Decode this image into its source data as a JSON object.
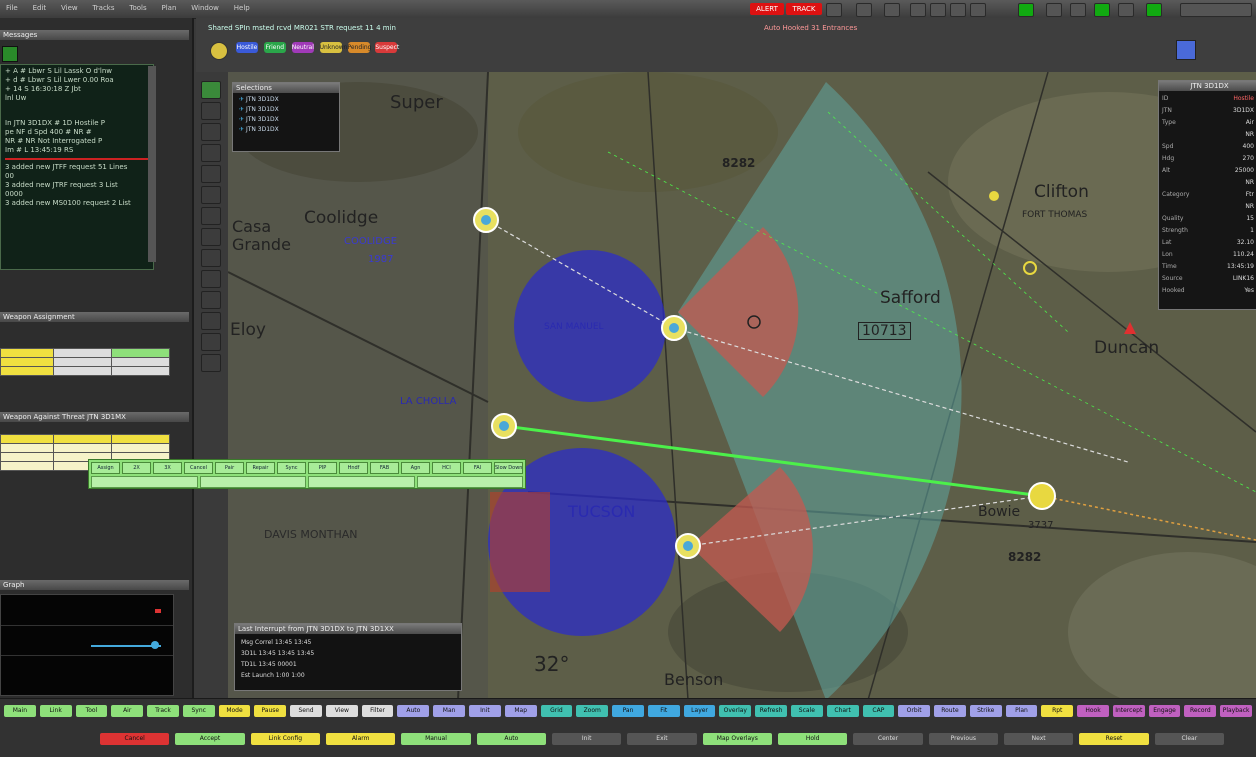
{
  "topbar": {
    "menus": [
      "File",
      "Edit",
      "View",
      "Tracks",
      "Tools",
      "Plan",
      "Window",
      "Help"
    ],
    "alert": "ALERT",
    "alert2": "TRACK"
  },
  "map_header": {
    "status_text": "Shared SPIn msted rcvd MR021 STR request 11 4 min",
    "warning": "Auto Hooked 31 Entrances",
    "filters": [
      "Hostile",
      "Friend",
      "Neutral",
      "Unknown",
      "Pending",
      "Suspect"
    ]
  },
  "left_panel": {
    "messages_title": "Messages",
    "message_lines": [
      "+ A # Lbwr S  Lil Lassk  O d'lnw",
      "+ d # Lbwr S  Lil Lwer  0.00 Roa",
      "+ 14 S  16:30:18 Z Jbt",
      "lnl Uw",
      "",
      "In JTN 3D1DX # 1D Hostile P",
      "pe NF d  Spd 400 # NR # ",
      "NR # NR  Not Interrogated P",
      "Im # L 13:45:19 RS"
    ],
    "message_lines_b": [
      "3 added new JTFF request 51 Lines",
      "00",
      "3 added new JTRF request 3 List",
      "0000",
      "3 added new MS0100 request 2 List"
    ],
    "engage_title": "Weapon Assignment",
    "engage_title2": "Weapon Against Threat  JTN 3D1MX",
    "graph_title": "Graph"
  },
  "selections": {
    "title": "Selections",
    "items": [
      "JTN 3D1DX",
      "JTN 3D1DX",
      "JTN 3D1DX",
      "JTN 3D1DX"
    ]
  },
  "track_panel": {
    "title": "JTN 3D1DX",
    "rows": [
      [
        "ID",
        "Hostile"
      ],
      [
        "JTN",
        "3D1DX"
      ],
      [
        "Type",
        "Air"
      ],
      [
        "",
        "NR"
      ],
      [
        "Spd",
        "400"
      ],
      [
        "Hdg",
        "270"
      ],
      [
        "Alt",
        "25000"
      ],
      [
        "",
        "NR"
      ],
      [
        "Category",
        "Ftr"
      ],
      [
        "",
        "NR"
      ],
      [
        "Quality",
        "15"
      ],
      [
        "Strength",
        "1"
      ],
      [
        "Lat",
        "32.10"
      ],
      [
        "Lon",
        "110.24"
      ],
      [
        "Time",
        "13:45:19"
      ],
      [
        "Source",
        "LINK16"
      ],
      [
        "Hooked",
        "Yes"
      ]
    ]
  },
  "info_panel": {
    "title": "Last Interrupt from JTN 3D1DX to JTN 3D1XX",
    "lines": [
      "Msg  Correl  13:45 13:45",
      "      3D1L  13:45   13:45  13:45",
      "      TD1L  13:45   00001",
      "Est Launch  1:00   1:00"
    ]
  },
  "green_toolbar": {
    "cells": [
      "Assign",
      "2X",
      "3X",
      "Cancel",
      "Pair",
      "Repair",
      "Sync",
      "PIP",
      "Hndf",
      "FAB",
      "Agn",
      "HCl",
      "FAl",
      "Slow Down"
    ]
  },
  "map_labels": {
    "superior": "Super",
    "casa_grande": "Casa\nGrande",
    "coolidge": "Coolidge",
    "coolidge_upper": "COOLIDGE",
    "coolidge_num": "1987",
    "eloy": "Eloy",
    "safford": "Safford",
    "duncan": "Duncan",
    "tucson": "TUCSON",
    "davis": "DAVIS MONTHAN",
    "benson": "Benson",
    "bowie": "Bowie",
    "la_cholla": "LA CHOLLA",
    "san_manuel": "SAN MANUEL",
    "fort_thomas": "FORT THOMAS",
    "num_8282": "8282",
    "num_10713": "10713",
    "deg_32": "32°",
    "num_3737": "3737",
    "num_8282b": "8282",
    "clifton": "Clifton"
  },
  "bottom": {
    "row1": [
      "Main",
      "Link",
      "Tool",
      "Air",
      "Track",
      "Sync",
      "Mode",
      "Pause",
      "Send",
      "View",
      "Filter",
      "Auto",
      "Man",
      "Init",
      "Map",
      "Grid",
      "Zoom",
      "Pan",
      "Fit",
      "Layer",
      "Overlay",
      "Refresh",
      "Scale",
      "Chart",
      "CAP",
      "Orbit",
      "Route",
      "Strike",
      "Plan",
      "Rpt",
      "Hook",
      "Intercept",
      "Engage",
      "Record",
      "Playback"
    ],
    "row2": [
      "Cancel",
      "Accept",
      "Link Config",
      "Alarm",
      "Manual",
      "Auto",
      "Init",
      "Exit",
      "Map Overlays",
      "Hold",
      "Center",
      "Previous",
      "Next",
      "Reset",
      "Clear"
    ]
  }
}
